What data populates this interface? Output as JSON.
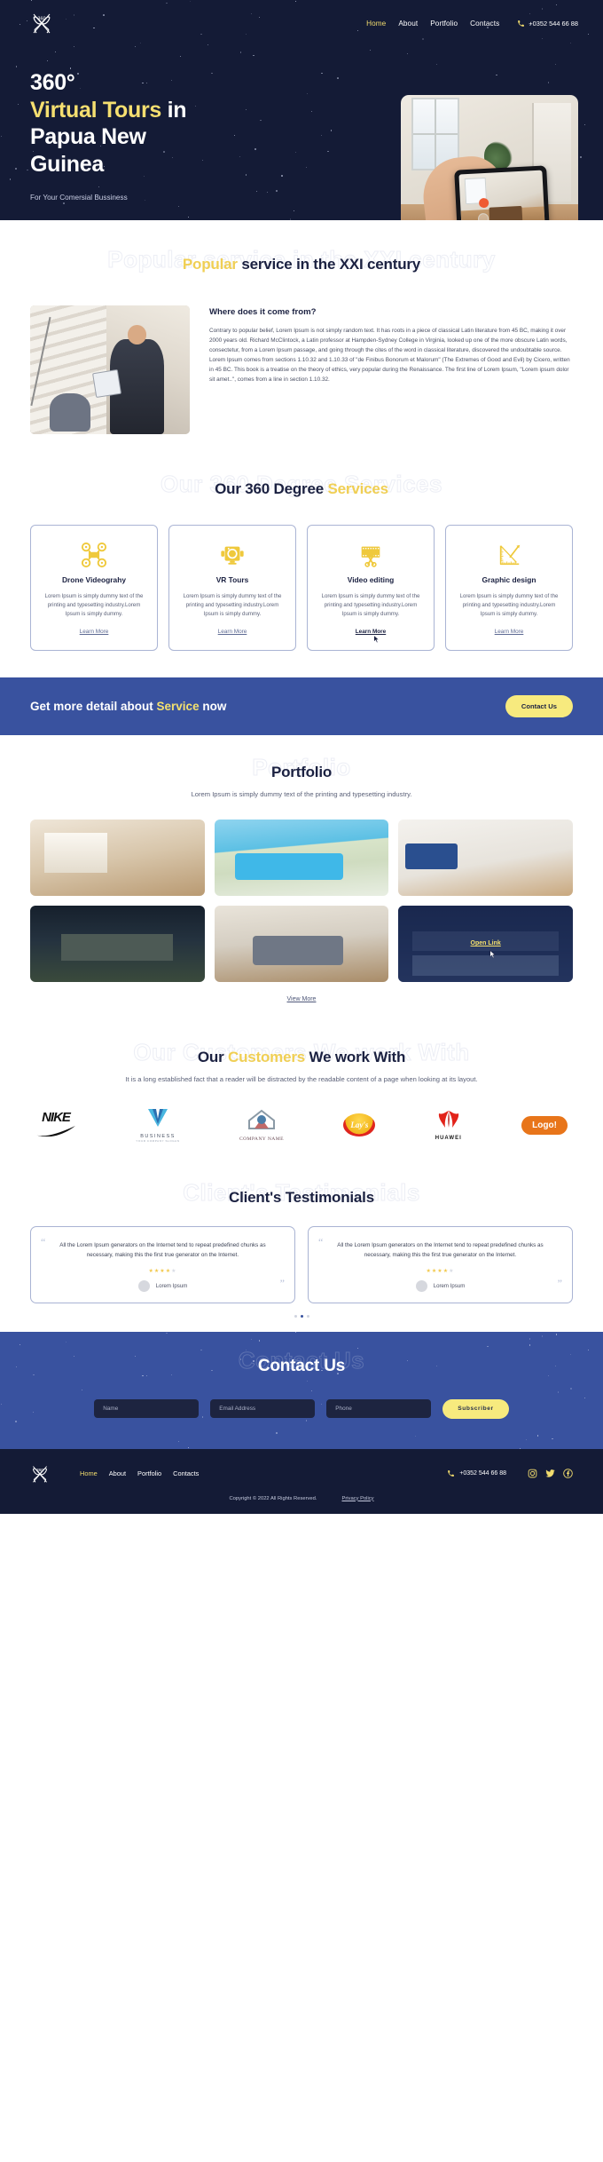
{
  "header": {
    "logo_icon": "360-butterfly-logo-icon",
    "nav": [
      {
        "label": "Home",
        "active": true
      },
      {
        "label": "About",
        "active": false
      },
      {
        "label": "Portfolio",
        "active": false
      },
      {
        "label": "Contacts",
        "active": false
      }
    ],
    "phone_icon": "phone-icon",
    "phone": "+0352 544 66 88"
  },
  "hero": {
    "title_line1": "360°",
    "title_highlight": "Virtual Tours",
    "title_line2_rest": " in",
    "title_line3": "Papua New",
    "title_line4": "Guinea",
    "subtitle": "For Your Comersial Bussiness",
    "image_alt": "hand-holding-phone-filming-room"
  },
  "popular": {
    "ghost": "Popular service in the XXI century",
    "title_highlight": "Popular",
    "title_rest": " service in the XXI century",
    "about": {
      "image_alt": "man-with-tablet-in-modern-interior",
      "heading": "Where does it come from?",
      "paragraph": "Contrary to popular belief, Lorem Ipsum is not simply random text. It has roots in a piece of classical Latin literature from 45 BC, making it over 2000 years old. Richard McClintock, a Latin professor at Hampden-Sydney College in Virginia, looked up one of the more obscure Latin words, consectetur, from a Lorem Ipsum passage, and going through the cites of the word in classical literature, discovered the undoubtable source. Lorem Ipsum comes from sections 1.10.32 and 1.10.33 of \"de Finibus Bonorum et Malorum\" (The Extremes of Good and Evil) by Cicero, written in 45 BC. This book is a treatise on the theory of ethics, very popular during the Renaissance. The first line of Lorem Ipsum, \"Lorem ipsum dolor sit amet..\", comes from a line in section 1.10.32."
    }
  },
  "services": {
    "ghost": "Our 360 Degree Services",
    "title_part1": "Our 360 Degree ",
    "title_highlight": "Services",
    "cards": [
      {
        "icon": "drone-icon",
        "title": "Drone Videograhy",
        "desc": "Lorem Ipsum is simply dummy text of the printing and typesetting industry.Lorem Ipsum is simply dummy.",
        "link": "Learn More",
        "hovered": false
      },
      {
        "icon": "vr-camera-icon",
        "title": "VR Tours",
        "desc": "Lorem Ipsum is simply dummy text of the printing and typesetting industry.Lorem Ipsum is simply dummy.",
        "link": "Learn More",
        "hovered": false
      },
      {
        "icon": "film-scissors-icon",
        "title": "Video editing",
        "desc": "Lorem Ipsum is simply dummy text of the printing and typesetting industry.Lorem Ipsum is simply dummy.",
        "link": "Learn More",
        "hovered": true
      },
      {
        "icon": "ruler-pencil-icon",
        "title": "Graphic design",
        "desc": "Lorem Ipsum is simply dummy text of the printing and typesetting industry.Lorem Ipsum is simply dummy.",
        "link": "Learn More",
        "hovered": false
      }
    ]
  },
  "cta": {
    "text_part1": "Get more detail about ",
    "text_highlight": "Service",
    "text_part2": " now",
    "button": "Contact Us",
    "bg_color": "#39529f",
    "button_color": "#f7ea7e"
  },
  "portfolio": {
    "ghost": "Portfolio",
    "title": "Portfolio",
    "subtitle": "Lorem Ipsum is simply dummy text of the printing and typesetting industry.",
    "tiles": [
      {
        "alt": "dining-room-with-window",
        "overlay": null
      },
      {
        "alt": "modern-villa-with-pool",
        "overlay": null
      },
      {
        "alt": "bright-living-room-sofa",
        "overlay": null
      },
      {
        "alt": "house-exterior-at-dusk",
        "overlay": null
      },
      {
        "alt": "dining-area-interior",
        "overlay": null
      },
      {
        "alt": "glass-office-building-night",
        "overlay": "Open Link"
      }
    ],
    "view_more": "View More"
  },
  "customers": {
    "ghost": "Our Customers We work With",
    "title_part1": "Our ",
    "title_highlight": "Customers",
    "title_part2": " We work With",
    "subtitle": "It is a long established fact that a reader will be distracted by the readable content of a page when looking at its layout.",
    "logos": [
      {
        "name": "NIKE",
        "icon": "nike-logo"
      },
      {
        "name": "BUSINESS",
        "sub": "YOUR COMPANY SLOGAN",
        "icon": "business-logo"
      },
      {
        "name": "COMPANY NAME",
        "icon": "company-name-house-logo"
      },
      {
        "name": "Lay's",
        "icon": "lays-logo"
      },
      {
        "name": "HUAWEI",
        "icon": "huawei-logo"
      },
      {
        "name": "Logo!",
        "icon": "logo-pill-logo"
      }
    ]
  },
  "testimonials": {
    "ghost": "Client's Testimonials",
    "title": "Client's Testimonials",
    "items": [
      {
        "quote": "All the Lorem Ipsum generators on the Internet tend to repeat predefined chunks as necessary, making this the first true generator on the Internet.",
        "rating": 4,
        "max_rating": 5,
        "author": "Lorem Ipsum"
      },
      {
        "quote": "All the Lorem Ipsum generators on the Internet tend to repeat predefined chunks as necessary, making this the first true generator on the Internet.",
        "rating": 4,
        "max_rating": 5,
        "author": "Lorem Ipsum"
      }
    ],
    "active_dot": 1,
    "dot_count": 3
  },
  "contact": {
    "ghost": "Contact Us",
    "title": "Contact Us",
    "fields": [
      {
        "name": "name",
        "placeholder": "Name",
        "value": ""
      },
      {
        "name": "email",
        "placeholder": "Email Address",
        "value": ""
      },
      {
        "name": "phone",
        "placeholder": "Phone",
        "value": ""
      }
    ],
    "button": "Subscriber"
  },
  "footer": {
    "logo_icon": "360-butterfly-logo-icon",
    "nav": [
      {
        "label": "Home",
        "active": true
      },
      {
        "label": "About",
        "active": false
      },
      {
        "label": "Portfolio",
        "active": false
      },
      {
        "label": "Contacts",
        "active": false
      }
    ],
    "phone_icon": "phone-icon",
    "phone": "+0352 544 66 88",
    "socials": [
      "instagram-icon",
      "twitter-icon",
      "facebook-icon"
    ],
    "copyright": "Copyright © 2022 All Rights Reserved.",
    "privacy": "Privacy Policy"
  },
  "colors": {
    "navy": "#141b36",
    "blue": "#39529f",
    "yellow": "#f5df70",
    "gold": "#efc93c"
  }
}
